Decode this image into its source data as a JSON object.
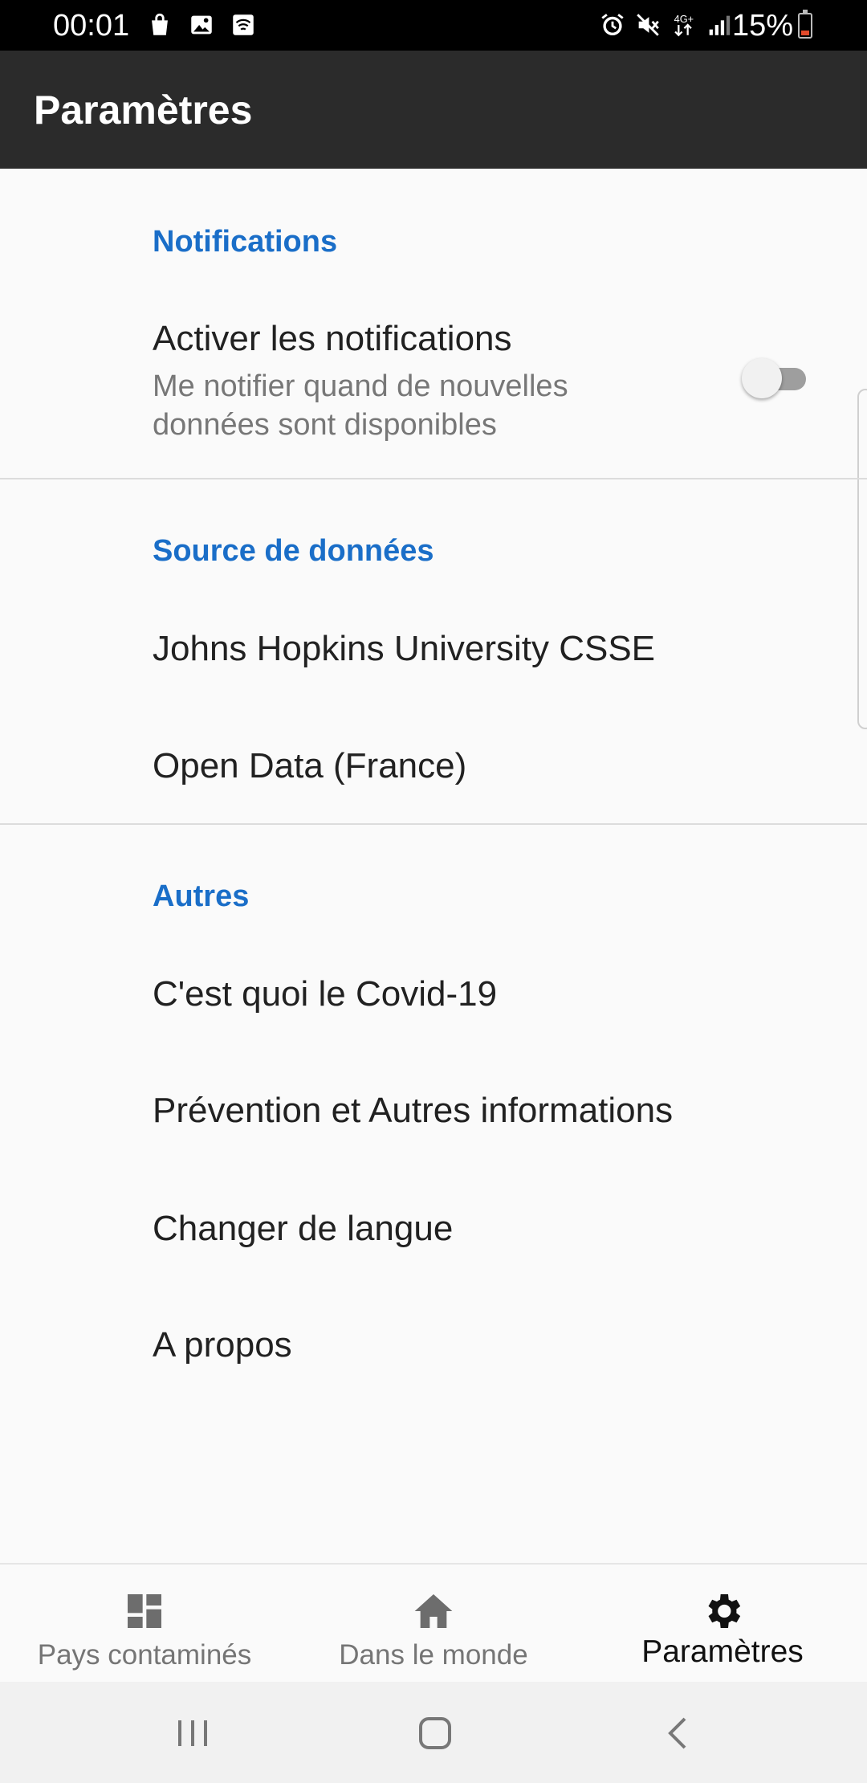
{
  "status_bar": {
    "time": "00:01",
    "battery": "15%",
    "network": "4G+",
    "left_icons": [
      "shopping-bag-icon",
      "image-icon",
      "wifi-call-icon"
    ],
    "right_icons": [
      "alarm-icon",
      "mute-icon",
      "data-arrows-icon",
      "signal-icon",
      "battery-icon"
    ]
  },
  "app_bar": {
    "title": "Paramètres"
  },
  "sections": {
    "notifications": {
      "header": "Notifications",
      "enable_title": "Activer les notifications",
      "enable_summary": "Me notifier quand de nouvelles données sont disponibles",
      "enabled": false
    },
    "data_source": {
      "header": "Source de données",
      "items": [
        "Johns Hopkins University CSSE",
        "Open Data (France)"
      ]
    },
    "others": {
      "header": "Autres",
      "items": [
        "C'est quoi le Covid-19",
        "Prévention et Autres informations",
        "Changer de langue",
        "A propos"
      ]
    }
  },
  "bottom_nav": {
    "items": [
      {
        "label": "Pays contaminés",
        "icon": "dashboard-icon"
      },
      {
        "label": "Dans le monde",
        "icon": "home-icon"
      },
      {
        "label": "Paramètres",
        "icon": "gear-icon"
      }
    ],
    "active_index": 2
  },
  "system_nav": {
    "buttons": [
      "recents-button",
      "home-button",
      "back-button"
    ]
  },
  "colors": {
    "accent": "#1a6ec8",
    "app_bar": "#2b2b2b",
    "background": "#fafafa",
    "battery_low": "#e24a2b"
  }
}
